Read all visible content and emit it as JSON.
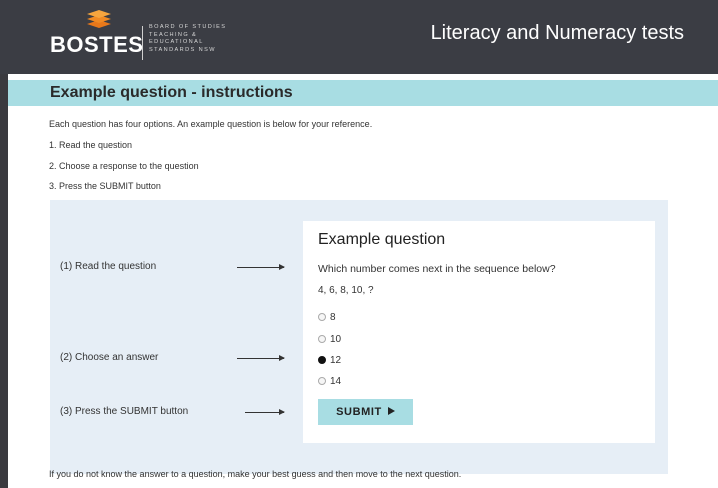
{
  "header": {
    "logo_text": "BOSTES",
    "logo_subtext": "BOARD OF STUDIES\nTEACHING &\nEDUCATIONAL\nSTANDARDS NSW",
    "app_title": "Literacy and Numeracy tests"
  },
  "section": {
    "title": "Example question - instructions",
    "intro": "Each question has four options. An example question is below for your reference.",
    "steps": [
      "1. Read the question",
      "2. Choose a response to the question",
      "3. Press the SUBMIT button"
    ]
  },
  "example": {
    "labels": [
      "(1) Read the question",
      "(2) Choose an answer",
      "(3) Press the SUBMIT button"
    ],
    "card_title": "Example question",
    "question": "Which number comes next in the sequence below?",
    "sequence": "4, 6, 8, 10, ?",
    "options": [
      "8",
      "10",
      "12",
      "14"
    ],
    "selected_option": "12",
    "submit_label": "SUBMIT"
  },
  "footer_note": "If you do not know the answer to a question, make your best guess and then move to the next question.",
  "colors": {
    "header_bg": "#3b3d44",
    "accent": "#a8dde3",
    "panel_bg": "#e6eef6",
    "logo_orange": "#f08a24"
  }
}
